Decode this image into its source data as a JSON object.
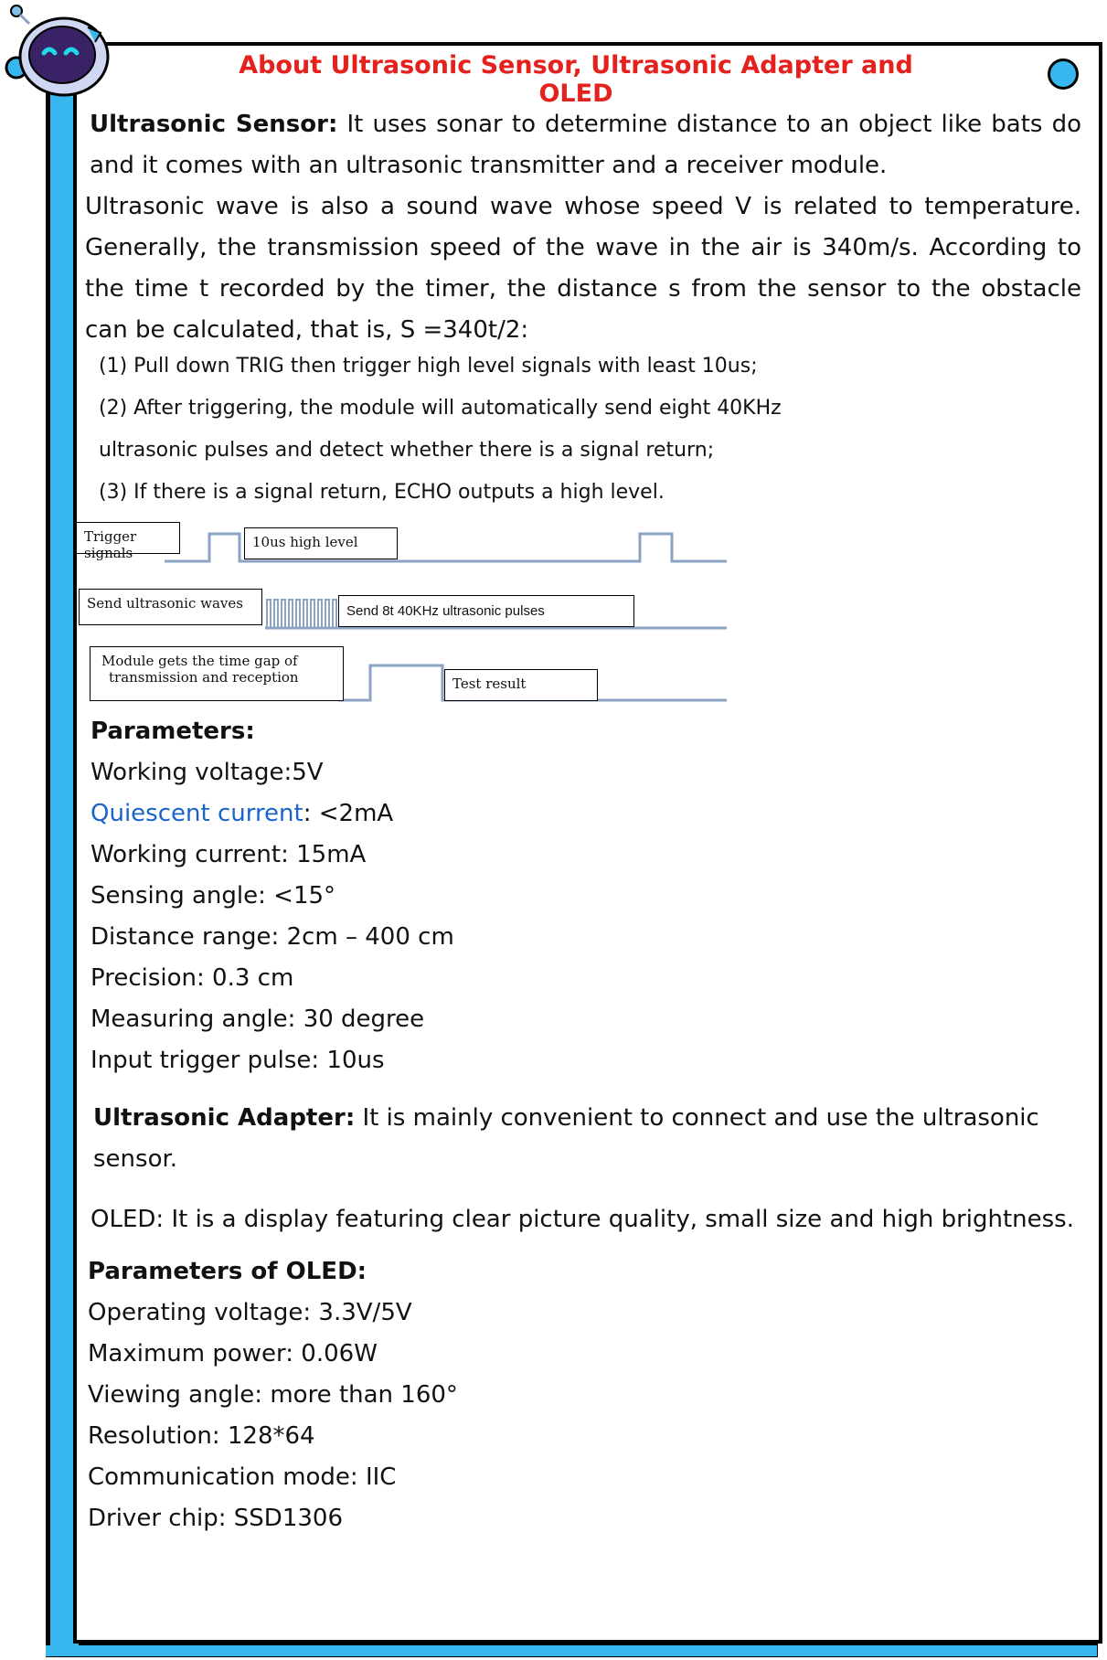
{
  "title": "About Ultrasonic Sensor, Ultrasonic Adapter and OLED",
  "sensor": {
    "heading": "Ultrasonic Sensor:",
    "intro": "It uses sonar to determine distance to an object like bats do and it comes with an ultrasonic transmitter and a receiver module.",
    "body": "Ultrasonic wave is also a sound wave whose speed V is related to temperature. Generally, the transmission speed of the wave in the air is 340m/s. According to the time t recorded by the timer, the distance s from the sensor to the obstacle can be calculated, that is, S =340t/2:",
    "steps": [
      "(1)  Pull down TRIG then trigger high level signals with least 10us;",
      "(2)  After triggering, the module will automatically send eight 40KHz",
      "ultrasonic pulses and detect whether there is a signal return;",
      "(3)  If there is a signal return, ECHO outputs a high level."
    ]
  },
  "diagram": {
    "trigger_label": "Trigger signals",
    "high_label": "10us high level",
    "send_label": "Send ultrasonic waves",
    "pulses_label": "Send 8t 40KHz ultrasonic pulses",
    "module_label_1": "Module gets the time gap of",
    "module_label_2": "transmission and reception",
    "result_label": "Test result"
  },
  "parameters": {
    "heading": "Parameters:",
    "working_voltage": "Working voltage:5V",
    "quiescent_label": "Quiescent current",
    "quiescent_value": ": <2mA",
    "items": [
      "Working current: 15mA",
      "Sensing angle: <15°",
      "Distance range: 2cm – 400 cm",
      "Precision: 0.3 cm",
      "Measuring angle: 30 degree",
      "Input trigger pulse: 10us"
    ]
  },
  "adapter": {
    "heading": "Ultrasonic Adapter:",
    "text_1": "It is mainly convenient to connect and use the ultrasonic",
    "text_2": "sensor."
  },
  "oled": {
    "heading": "OLED:",
    "text": "It is a display featuring clear picture quality, small size and high brightness.",
    "params_heading": "Parameters of OLED:",
    "items": [
      "Operating voltage: 3.3V/5V",
      "Maximum power: 0.06W",
      "Viewing angle: more than 160°",
      "Resolution: 128*64",
      "Communication mode: IIC",
      "Driver chip: SSD1306"
    ]
  },
  "colors": {
    "accent": "#37b7ee",
    "title": "#e4211c",
    "link": "#1a64c7"
  },
  "icons": {
    "mascot": "robot-mascot-icon",
    "corner": "dot-icon"
  }
}
